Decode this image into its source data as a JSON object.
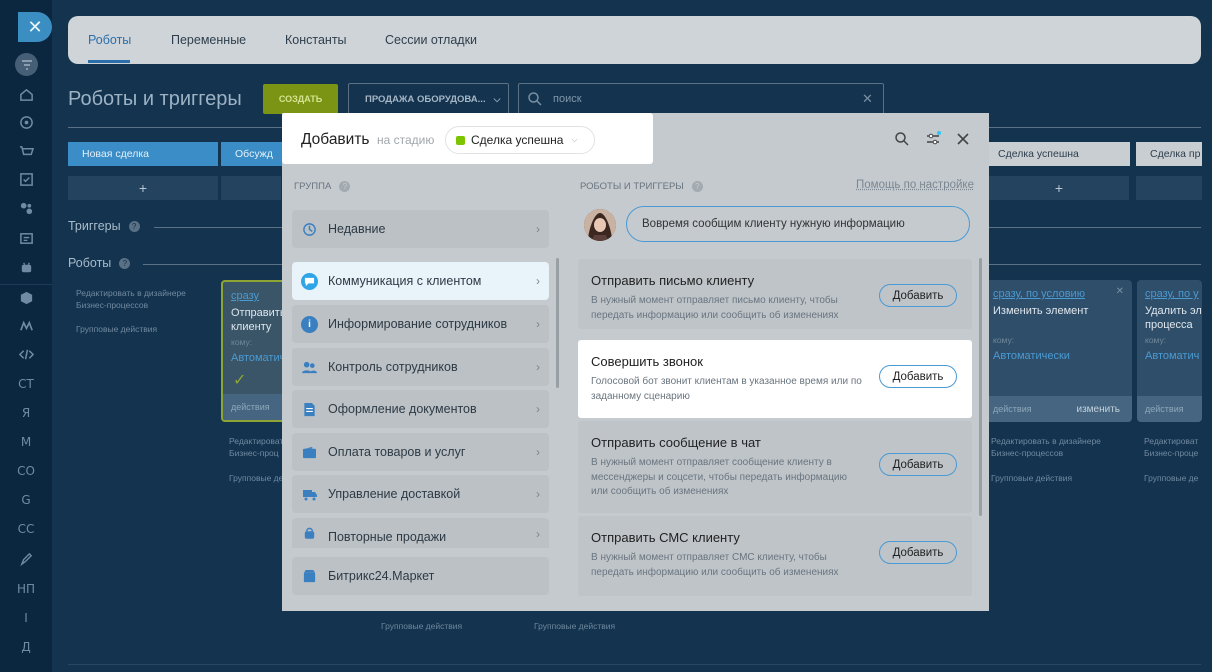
{
  "rail": {
    "icons": [
      "filter-icon",
      "home-icon",
      "target-icon",
      "cart-icon",
      "check-square-icon",
      "puzzle-icon",
      "id-card-icon",
      "robot-icon",
      "box-icon",
      "mail-icon",
      "code-icon"
    ],
    "labels": [
      "СТ",
      "Я",
      "М",
      "СО",
      "G",
      "СС",
      "НП",
      "I",
      "Д"
    ]
  },
  "tabs": [
    "Роботы",
    "Переменные",
    "Константы",
    "Сессии отладки"
  ],
  "page_title": "Роботы и триггеры",
  "create_button": "СОЗДАТЬ",
  "pipeline_select": "ПРОДАЖА ОБОРУДОВА...",
  "search": {
    "placeholder": "поиск"
  },
  "stages": [
    "Новая сделка",
    "Обсужд",
    "Сделка успешна",
    "Сделка пр"
  ],
  "stage_colors": {
    "new": "#3b8dc7",
    "success": "#c9ced2"
  },
  "sections": {
    "triggers": "Триггеры",
    "robots": "Роботы"
  },
  "side_links": {
    "designer": "Редактировать в дизайнере Бизнес-процессов",
    "group": "Групповые действия"
  },
  "cards": [
    {
      "link": "сразу",
      "title": "Отправить клиенту",
      "to": "кому:",
      "auto": "Автоматич",
      "foot": "действия"
    },
    {
      "link": "сразу, по условию",
      "title": "Изменить элемент",
      "to": "кому:",
      "auto": "Автоматически",
      "foot": "действия",
      "edit": "изменить"
    },
    {
      "link": "сразу, по у",
      "title": "Удалить эл процесса",
      "to": "кому:",
      "auto": "Автоматич",
      "foot": "действия"
    }
  ],
  "card_links": {
    "designer1": "Редактироват Бизнес-проц",
    "designer2": "Редактировать в дизайнере Бизнес-процессов",
    "designer3": "Редактироват Бизнес-проце",
    "group1": "Групповые дей",
    "group2": "Групповые действия",
    "group3": "Групповые де"
  },
  "popup": {
    "title": "Добавить",
    "stage_label": "на стадию",
    "stage_value": "Сделка успешна",
    "stage_color": "#7dc400",
    "group_label": "ГРУППА",
    "robots_label": "РОБОТЫ И ТРИГГЕРЫ",
    "help_link": "Помощь по настройке",
    "tip": "Вовремя сообщим клиенту нужную информацию",
    "groups": [
      {
        "label": "Недавние",
        "icon": "history-icon"
      },
      {
        "label": "Коммуникация с клиентом",
        "icon": "chat-icon"
      },
      {
        "label": "Информирование сотрудников",
        "icon": "info-icon"
      },
      {
        "label": "Контроль сотрудников",
        "icon": "people-icon"
      },
      {
        "label": "Оформление документов",
        "icon": "document-icon"
      },
      {
        "label": "Оплата товаров и услуг",
        "icon": "wallet-icon"
      },
      {
        "label": "Управление доставкой",
        "icon": "truck-icon"
      },
      {
        "label": "Повторные продажи",
        "icon": "repeat-sales-icon"
      },
      {
        "label": "Битрикс24.Маркет",
        "icon": "market-icon"
      }
    ],
    "robots": [
      {
        "title": "Отправить письмо клиенту",
        "desc": "В нужный момент отправляет письмо клиенту, чтобы передать информацию или сообщить об изменениях",
        "button": "Добавить"
      },
      {
        "title": "Совершить звонок",
        "desc": "Голосовой бот звонит клиентам в указанное время или по заданному сценарию",
        "button": "Добавить"
      },
      {
        "title": "Отправить сообщение в чат",
        "desc": "В нужный момент отправляет сообщение клиенту в мессенджеры и соцсети, чтобы передать информацию или сообщить об изменениях",
        "button": "Добавить"
      },
      {
        "title": "Отправить СМС клиенту",
        "desc": "В нужный момент отправляет СМС клиенту, чтобы передать информацию или сообщить об изменениях",
        "button": "Добавить"
      }
    ]
  },
  "bottom": {
    "group1": "Групповые действия",
    "group2": "Групповые действия"
  }
}
